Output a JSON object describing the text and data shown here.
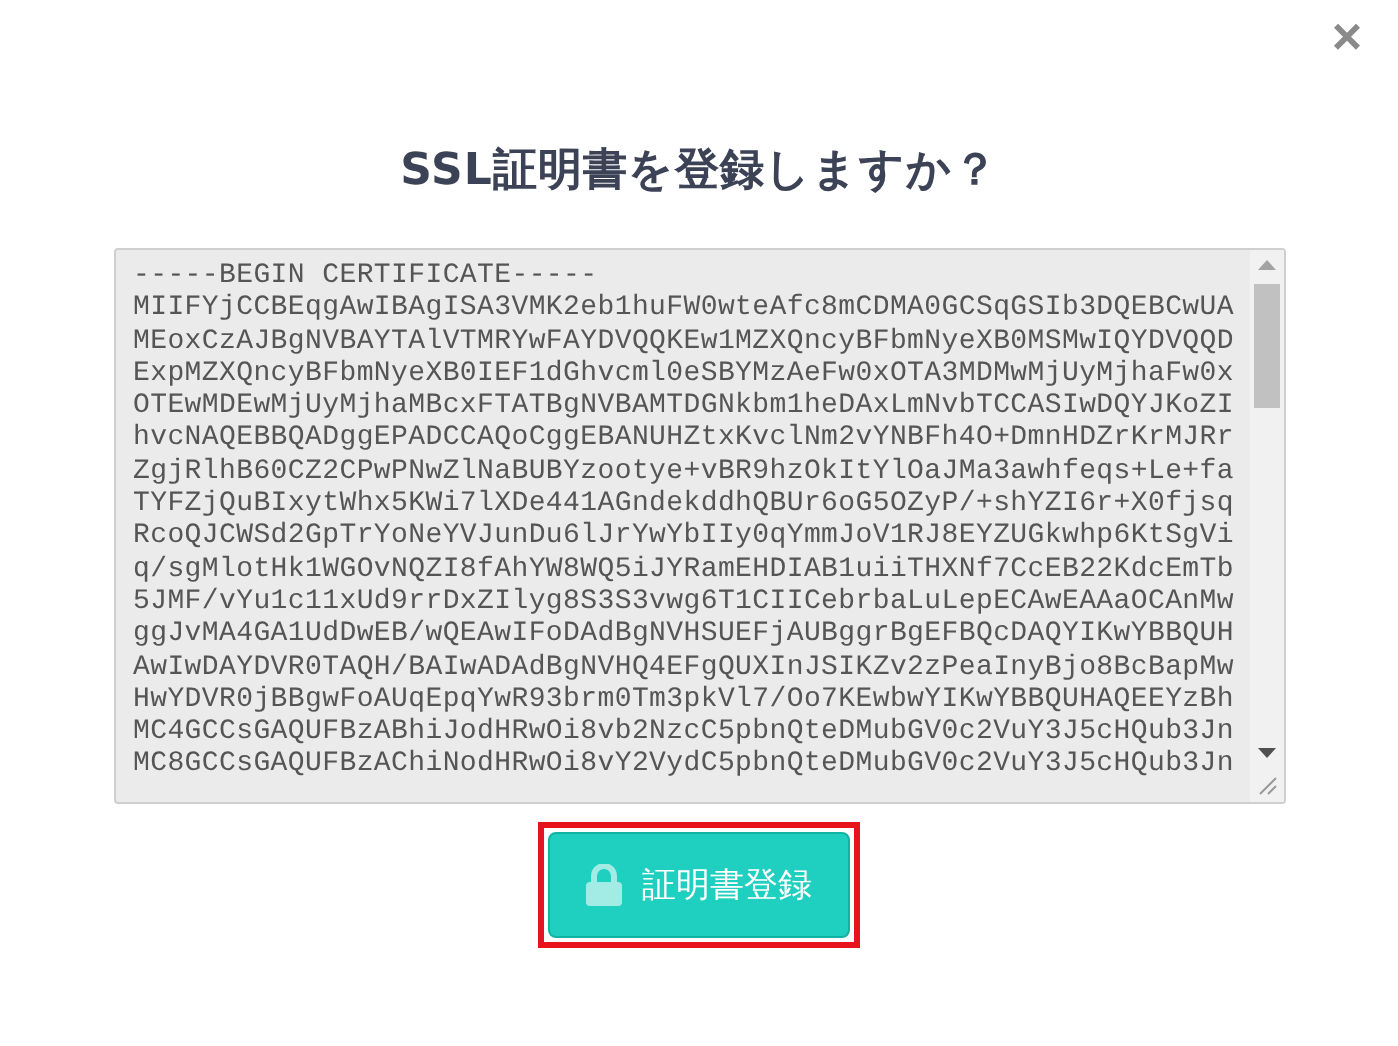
{
  "close_button": {
    "label": "×"
  },
  "title": "SSL証明書を登録しますか？",
  "certificate": {
    "lines": [
      "-----BEGIN CERTIFICATE-----",
      "MIIFYjCCBEqgAwIBAgISA3VMK2eb1huFW0wteAfc8mCDMA0GCSqGSIb3DQEBCwUA",
      "MEoxCzAJBgNVBAYTAlVTMRYwFAYDVQQKEw1MZXQncyBFbmNyeXB0MSMwIQYDVQQD",
      "ExpMZXQncyBFbmNyeXB0IEF1dGhvcml0eSBYMzAeFw0xOTA3MDMwMjUyMjhaFw0x",
      "OTEwMDEwMjUyMjhaMBcxFTATBgNVBAMTDGNkbm1heDAxLmNvbTCCASIwDQYJKoZI",
      "hvcNAQEBBQADggEPADCCAQoCggEBANUHZtxKvclNm2vYNBFh4O+DmnHDZrKrMJRr",
      "ZgjRlhB60CZ2CPwPNwZlNaBUBYzootye+vBR9hzOkItYlOaJMa3awhfeqs+Le+fa",
      "TYFZjQuBIxytWhx5KWi7lXDe441AGndekddhQBUr6oG5OZyP/+shYZI6r+X0fjsq",
      "RcoQJCWSd2GpTrYoNeYVJunDu6lJrYwYbIIy0qYmmJoV1RJ8EYZUGkwhp6KtSgVi",
      "q/sgMlotHk1WGOvNQZI8fAhYW8WQ5iJYRamEHDIAB1uiiTHXNf7CcEB22KdcEmTb",
      "5JMF/vYu1c11xUd9rrDxZIlyg8S3S3vwg6T1CIICebrbaLuLepECAwEAAaOCAnMw",
      "ggJvMA4GA1UdDwEB/wQEAwIFoDAdBgNVHSUEFjAUBggrBgEFBQcDAQYIKwYBBQUH",
      "AwIwDAYDVR0TAQH/BAIwADAdBgNVHQ4EFgQUXInJSIKZv2zPeaInyBjo8BcBapMw",
      "HwYDVR0jBBgwFoAUqEpqYwR93brm0Tm3pkVl7/Oo7KEwbwYIKwYBBQUHAQEEYzBh",
      "MC4GCCsGAQUFBzABhiJodHRwOi8vb2NzcC5pbnQteDMubGV0c2VuY3J5cHQub3Jn",
      "MC8GCCsGAQUFBzAChiNodHRwOi8vY2VydC5pbnQteDMubGV0c2VuY3J5cHQub3Jn"
    ]
  },
  "register_button": {
    "label": "証明書登録"
  }
}
